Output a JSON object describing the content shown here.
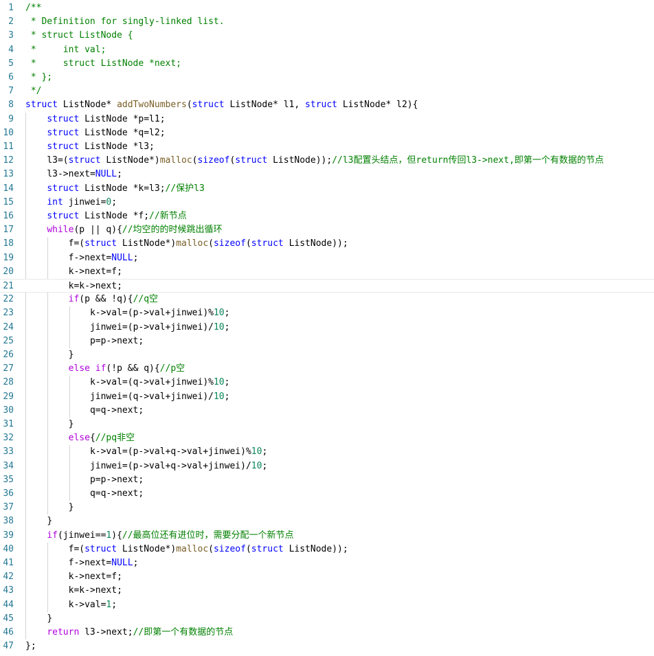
{
  "editor": {
    "language": "c",
    "colors": {
      "comment": "#008000",
      "keyword": "#0000ff",
      "control": "#af00db",
      "function": "#795e26",
      "number": "#098658",
      "variable": "#001080",
      "plain": "#000000",
      "line_number": "#237893"
    },
    "current_line": 21,
    "lines": [
      {
        "n": "1",
        "text": "/**"
      },
      {
        "n": "2",
        "text": " * Definition for singly-linked list."
      },
      {
        "n": "3",
        "text": " * struct ListNode {"
      },
      {
        "n": "4",
        "text": " *     int val;"
      },
      {
        "n": "5",
        "text": " *     struct ListNode *next;"
      },
      {
        "n": "6",
        "text": " * };"
      },
      {
        "n": "7",
        "text": " */"
      },
      {
        "n": "8",
        "text": "struct ListNode* addTwoNumbers(struct ListNode* l1, struct ListNode* l2){"
      },
      {
        "n": "9",
        "text": "    struct ListNode *p=l1;"
      },
      {
        "n": "10",
        "text": "    struct ListNode *q=l2;"
      },
      {
        "n": "11",
        "text": "    struct ListNode *l3;"
      },
      {
        "n": "12",
        "text": "    l3=(struct ListNode*)malloc(sizeof(struct ListNode));//l3配置头结点，但return传回l3->next,即第一个有数据的节点"
      },
      {
        "n": "13",
        "text": "    l3->next=NULL;"
      },
      {
        "n": "14",
        "text": "    struct ListNode *k=l3;//保护l3"
      },
      {
        "n": "15",
        "text": "    int jinwei=0;"
      },
      {
        "n": "16",
        "text": "    struct ListNode *f;//新节点"
      },
      {
        "n": "17",
        "text": "    while(p || q){//均空的的时候跳出循环"
      },
      {
        "n": "18",
        "text": "        f=(struct ListNode*)malloc(sizeof(struct ListNode));"
      },
      {
        "n": "19",
        "text": "        f->next=NULL;"
      },
      {
        "n": "20",
        "text": "        k->next=f;"
      },
      {
        "n": "21",
        "text": "        k=k->next;"
      },
      {
        "n": "22",
        "text": "        if(p && !q){//q空"
      },
      {
        "n": "23",
        "text": "            k->val=(p->val+jinwei)%10;"
      },
      {
        "n": "24",
        "text": "            jinwei=(p->val+jinwei)/10;"
      },
      {
        "n": "25",
        "text": "            p=p->next;"
      },
      {
        "n": "26",
        "text": "        }"
      },
      {
        "n": "27",
        "text": "        else if(!p && q){//p空"
      },
      {
        "n": "28",
        "text": "            k->val=(q->val+jinwei)%10;"
      },
      {
        "n": "29",
        "text": "            jinwei=(q->val+jinwei)/10;"
      },
      {
        "n": "30",
        "text": "            q=q->next;"
      },
      {
        "n": "31",
        "text": "        }"
      },
      {
        "n": "32",
        "text": "        else{//pq非空"
      },
      {
        "n": "33",
        "text": "            k->val=(p->val+q->val+jinwei)%10;"
      },
      {
        "n": "34",
        "text": "            jinwei=(p->val+q->val+jinwei)/10;"
      },
      {
        "n": "35",
        "text": "            p=p->next;"
      },
      {
        "n": "36",
        "text": "            q=q->next;"
      },
      {
        "n": "37",
        "text": "        }"
      },
      {
        "n": "38",
        "text": "    }"
      },
      {
        "n": "39",
        "text": "    if(jinwei==1){//最高位还有进位时，需要分配一个新节点"
      },
      {
        "n": "40",
        "text": "        f=(struct ListNode*)malloc(sizeof(struct ListNode));"
      },
      {
        "n": "41",
        "text": "        f->next=NULL;"
      },
      {
        "n": "42",
        "text": "        k->next=f;"
      },
      {
        "n": "43",
        "text": "        k=k->next;"
      },
      {
        "n": "44",
        "text": "        k->val=1;"
      },
      {
        "n": "45",
        "text": "    }"
      },
      {
        "n": "46",
        "text": "    return l3->next;//即第一个有数据的节点"
      },
      {
        "n": "47",
        "text": "};"
      }
    ]
  }
}
